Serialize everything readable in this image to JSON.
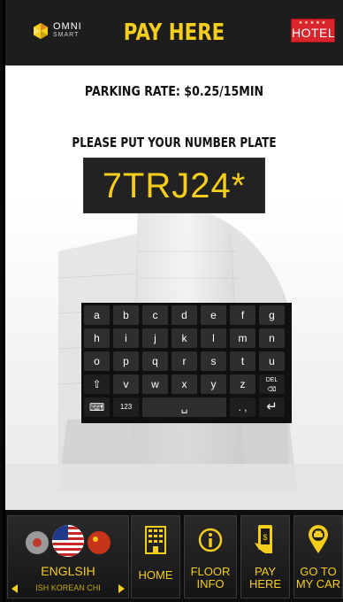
{
  "header": {
    "logo_text": "OMNI",
    "logo_sub": "SMART",
    "title": "PAY HERE",
    "hotel_label": "HOTEL",
    "hotel_stars": "★★★★★"
  },
  "main": {
    "rate": "PARKING RATE: $0.25/15MIN",
    "prompt": "PLEASE PUT YOUR NUMBER PLATE",
    "plate_value": "7TRJ24*"
  },
  "keyboard": {
    "row1": [
      "a",
      "b",
      "c",
      "d",
      "e",
      "f",
      "g"
    ],
    "row2": [
      "h",
      "i",
      "j",
      "k",
      "l",
      "m",
      "n"
    ],
    "row3": [
      "o",
      "p",
      "q",
      "r",
      "s",
      "t",
      "u"
    ],
    "row4": [
      "⇧",
      "v",
      "w",
      "x",
      "y",
      "z",
      "DEL"
    ],
    "row5": {
      "keyboard": "⌨",
      "numbers": "123",
      "space": "␣",
      "punct": ". ,",
      "enter": "↵"
    }
  },
  "nav": {
    "language": {
      "label": "ENGLSIH",
      "strip": "ISH KOREAN CHI"
    },
    "home": "HOME",
    "floor": [
      "FLOOR",
      "INFO"
    ],
    "pay": [
      "PAY",
      "HERE"
    ],
    "car": [
      "GO TO",
      "MY CAR"
    ]
  },
  "colors": {
    "accent": "#f5cd1c",
    "hotel_red": "#d8262c",
    "header_bg": "#1d1d1d"
  }
}
